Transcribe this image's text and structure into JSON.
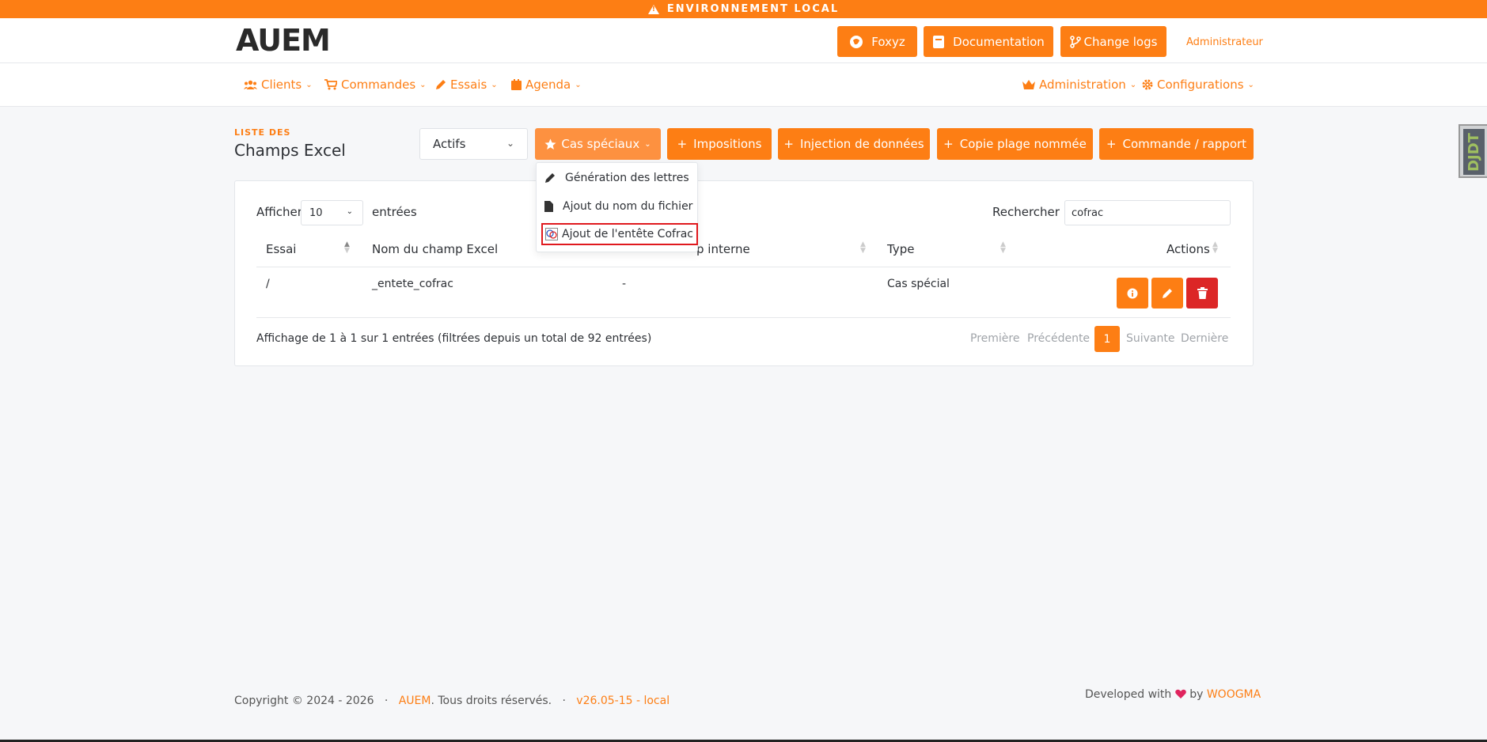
{
  "banner": {
    "text": "ENVIRONNEMENT LOCAL"
  },
  "header": {
    "logo_text": "AUEM",
    "buttons": {
      "foxyz": "Foxyz",
      "documentation": "Documentation",
      "changelogs": "Change logs"
    },
    "user": "Administrateur"
  },
  "nav": {
    "left": [
      "Clients",
      "Commandes",
      "Essais",
      "Agenda"
    ],
    "right": [
      "Administration",
      "Configurations"
    ]
  },
  "page": {
    "subtitle": "LISTE DES",
    "title": "Champs Excel"
  },
  "toolbar": {
    "status_select": "Actifs",
    "cas_speciaux": "Cas spéciaux",
    "impositions": "Impositions",
    "injection": "Injection de données",
    "copie": "Copie plage nommée",
    "commande": "Commande / rapport"
  },
  "dropdown": {
    "items": [
      "Génération des lettres",
      "Ajout du nom du fichier",
      "Ajout de l'entête Cofrac"
    ]
  },
  "table": {
    "show_label": "Afficher",
    "page_length": "10",
    "entries_label": "entrées",
    "search_label": "Rechercher :",
    "search_value": "cofrac",
    "headers": [
      "Essai",
      "Nom du champ Excel",
      "p interne",
      "Type",
      "Actions"
    ],
    "rows": [
      {
        "essai": "/",
        "nom": "_entete_cofrac",
        "interne": "-",
        "type": "Cas spécial"
      }
    ],
    "info": "Affichage de 1 à 1 sur 1 entrées (filtrées depuis un total de 92 entrées)",
    "pagination": {
      "first": "Première",
      "prev": "Précédente",
      "current": "1",
      "next": "Suivante",
      "last": "Dernière"
    }
  },
  "debug_toolbar": "DJDT",
  "footer": {
    "copyright": "Copyright © 2024 - 2026",
    "sep": "·",
    "brand": "AUEM",
    "rights": ". Tous droits réservés.",
    "version": "v26.05-15 - local",
    "developed": "Developed with",
    "by": "by",
    "company": "WOOGMA"
  },
  "colors": {
    "accent": "#fd7e14",
    "danger": "#dc2626",
    "highlight": "#e0191e"
  }
}
